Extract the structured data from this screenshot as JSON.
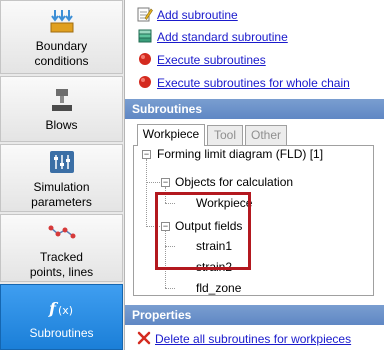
{
  "sidebar": {
    "items": [
      {
        "label": "Boundary\nconditions",
        "icon": "boundary-conditions-icon"
      },
      {
        "label": "Blows",
        "icon": "blows-icon"
      },
      {
        "label": "Simulation\nparameters",
        "icon": "simulation-parameters-icon"
      },
      {
        "label": "Tracked\npoints, lines",
        "icon": "tracked-points-icon"
      },
      {
        "label": "Subroutines",
        "icon": "subroutines-icon",
        "active": true
      }
    ]
  },
  "actions": {
    "add_subroutine": "Add subroutine",
    "add_standard_subroutine": "Add standard subroutine",
    "execute_subroutines": "Execute subroutines",
    "execute_whole_chain": "Execute subroutines for whole chain"
  },
  "subroutines": {
    "header": "Subroutines",
    "tabs": [
      "Workpiece",
      "Tool",
      "Other"
    ],
    "tree": {
      "root": "Forming limit diagram (FLD) [1]",
      "objects_group": "Objects for calculation",
      "object_item": "Workpiece",
      "output_group": "Output fields",
      "outputs": [
        "strain1",
        "strain2",
        "fld_zone"
      ]
    }
  },
  "properties": {
    "header": "Properties",
    "delete_all": "Delete all subroutines for workpieces"
  },
  "colors": {
    "accent_active": "#2a8ce4",
    "section_header": "#6a90c8",
    "highlight_box": "#b3181f",
    "link": "#1a1acc"
  }
}
